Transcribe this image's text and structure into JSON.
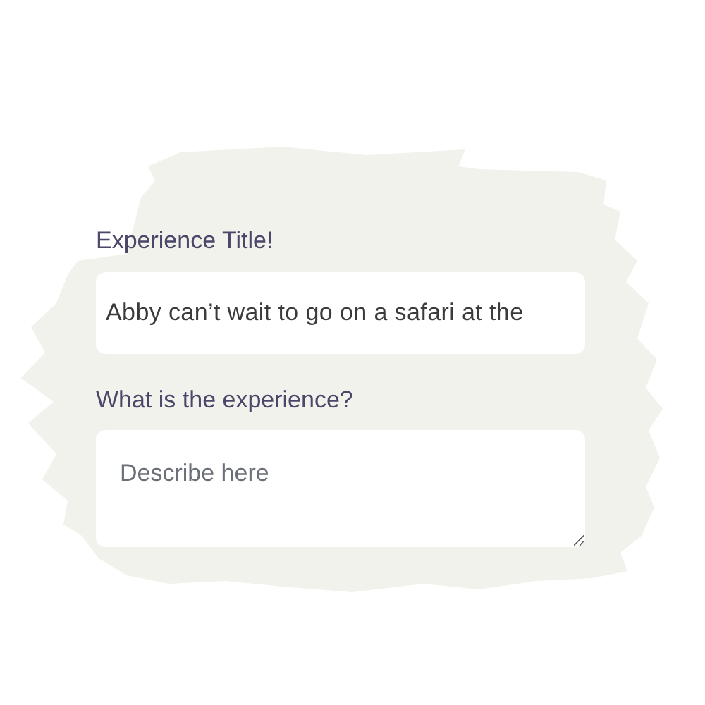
{
  "fields": [
    {
      "kind": "input",
      "label": "Experience Title!",
      "value": "Abby can’t wait to go on a safari at the"
    },
    {
      "kind": "textarea",
      "label": "What is the experience?",
      "placeholder": "Describe here"
    }
  ]
}
